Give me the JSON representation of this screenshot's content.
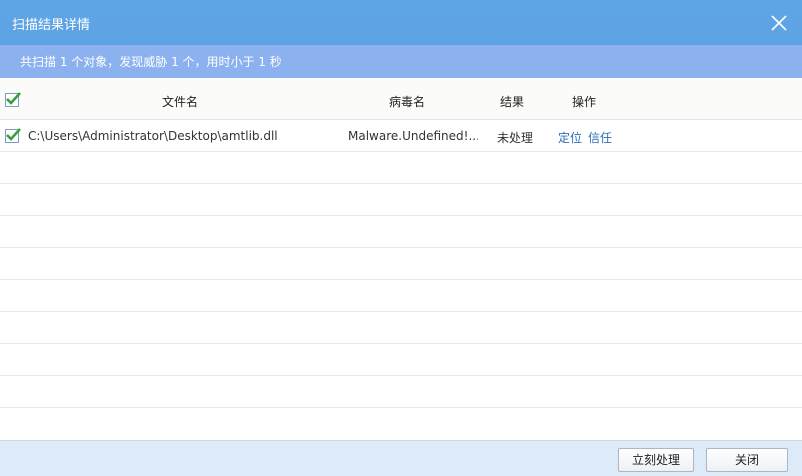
{
  "window": {
    "title": "扫描结果详情",
    "close_icon": "close-icon"
  },
  "summary": {
    "text": "共扫描 1 个对象，发现威胁 1 个，用时小于 1 秒"
  },
  "table": {
    "headers": {
      "filename": "文件名",
      "virus": "病毒名",
      "result": "结果",
      "action": "操作"
    },
    "rows": [
      {
        "checked": true,
        "filename": "C:\\Users\\Administrator\\Desktop\\amtlib.dll",
        "virus": "Malware.Undefined!...",
        "result": "未处理",
        "action_locate": "定位",
        "action_trust": "信任"
      }
    ]
  },
  "footer": {
    "process_label": "立刻处理",
    "close_label": "关闭"
  },
  "colors": {
    "titlebar": "#5fa6e6",
    "summary_bar": "#8cb1ef",
    "check": "#3a9e3a",
    "link": "#2a6fb8",
    "footer": "#ddeaf7"
  }
}
